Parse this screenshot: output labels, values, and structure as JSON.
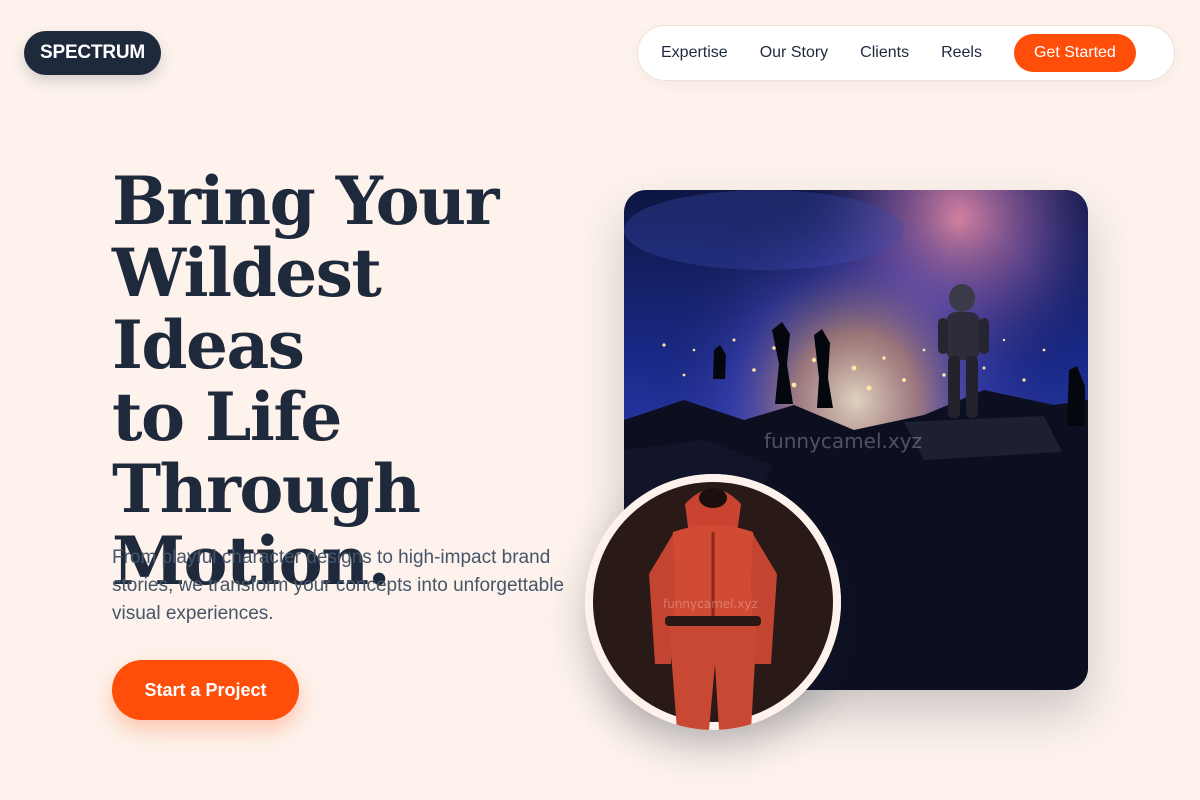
{
  "brand": {
    "logo_text": "SPECTRUM"
  },
  "nav": {
    "items": [
      {
        "label": "Expertise"
      },
      {
        "label": "Our Story"
      },
      {
        "label": "Clients"
      },
      {
        "label": "Reels"
      }
    ],
    "cta_label": "Get Started"
  },
  "hero": {
    "title_lines": [
      "Bring Your",
      "Wildest Ideas",
      "to Life",
      "Through",
      "Motion."
    ],
    "description": "From playful character designs to high-impact brand stories, we transform your concepts into unforgettable visual experiences.",
    "cta_label": "Start a Project"
  },
  "images": {
    "main_watermark": "funnycamel.xyz",
    "inset_watermark": "funnycamel.xyz"
  },
  "colors": {
    "background": "#fdf3ec",
    "accent": "#ff4d0a",
    "dark": "#1e293b",
    "muted_text": "#475569"
  }
}
